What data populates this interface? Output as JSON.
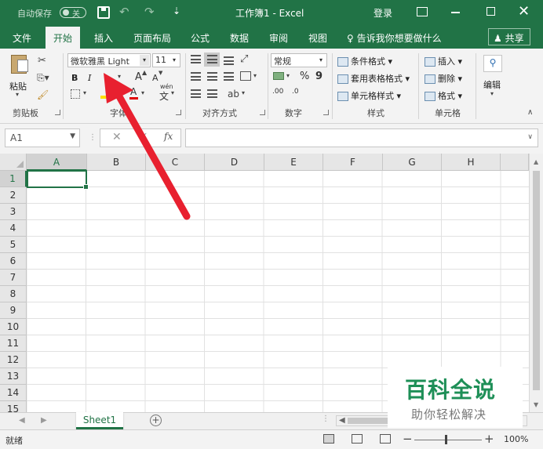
{
  "titlebar": {
    "autosave_label": "自动保存",
    "autosave_state": "关",
    "customize": "⇣",
    "doc_title": "工作簿1 - Excel",
    "login": "登录"
  },
  "tabs": [
    {
      "label": "文件",
      "active": false
    },
    {
      "label": "开始",
      "active": true
    },
    {
      "label": "插入",
      "active": false
    },
    {
      "label": "页面布局",
      "active": false
    },
    {
      "label": "公式",
      "active": false
    },
    {
      "label": "数据",
      "active": false
    },
    {
      "label": "审阅",
      "active": false
    },
    {
      "label": "视图",
      "active": false
    }
  ],
  "tell_me": "告诉我你想要做什么",
  "share": "共享",
  "ribbon": {
    "clipboard": {
      "label": "剪贴板",
      "paste": "粘贴"
    },
    "font": {
      "label": "字体",
      "family": "微软雅黑 Light",
      "size": "11",
      "bold": "B",
      "italic": "I",
      "grow": "A",
      "shrink": "A",
      "wen": "wén"
    },
    "alignment": {
      "label": "对齐方式"
    },
    "number": {
      "label": "数字",
      "format": "常规",
      "percent": "%",
      "comma": "9",
      "dec_inc": ".00",
      "dec_dec": ".0"
    },
    "styles": {
      "label": "样式",
      "conditional": "条件格式",
      "table": "套用表格格式",
      "cell_styles": "单元格样式"
    },
    "cells": {
      "label": "单元格",
      "insert": "插入",
      "delete": "删除",
      "format": "格式"
    },
    "editing": {
      "label": "编辑"
    }
  },
  "formula_bar": {
    "name_box": "A1",
    "fx": "fx",
    "value": ""
  },
  "grid": {
    "columns": [
      "A",
      "B",
      "C",
      "D",
      "E",
      "F",
      "G",
      "H"
    ],
    "rows": [
      "1",
      "2",
      "3",
      "4",
      "5",
      "6",
      "7",
      "8",
      "9",
      "10",
      "11",
      "12",
      "13",
      "14",
      "15"
    ],
    "active_cell": "A1"
  },
  "sheets": [
    {
      "name": "Sheet1",
      "active": true
    }
  ],
  "statusbar": {
    "ready": "就绪",
    "zoom": "100%"
  },
  "watermark": {
    "title": "百科全说",
    "subtitle": "助你轻松解决"
  },
  "colors": {
    "brand": "#217346",
    "arrow": "#e8202f",
    "watermark": "#1e8f57"
  }
}
